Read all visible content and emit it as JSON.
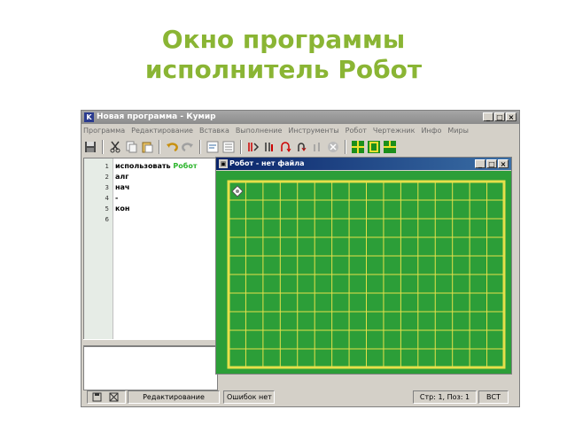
{
  "slide": {
    "title_line1": "Окно программы",
    "title_line2": "исполнитель Робот"
  },
  "window": {
    "app_icon": "K",
    "title": "Новая программа - Кумир",
    "minimize": "_",
    "maximize": "□",
    "close": "×"
  },
  "menu": [
    "Программа",
    "Редактирование",
    "Вставка",
    "Выполнение",
    "Инструменты",
    "Робот",
    "Чертежник",
    "Инфо",
    "Миры"
  ],
  "toolbar": {
    "icons": [
      "save-icon",
      "cut-icon",
      "copy-icon",
      "paste-icon",
      "undo-icon",
      "redo-icon",
      "insert-icon",
      "list-icon",
      "run-icon",
      "step-icon",
      "step-into-icon",
      "step-out-icon",
      "pause-icon",
      "stop-icon",
      "grid-icon",
      "square-icon",
      "field-icon"
    ]
  },
  "editor": {
    "line_numbers": [
      "1",
      "2",
      "3",
      "4",
      "5",
      "6"
    ],
    "lines": [
      {
        "pre": "использовать ",
        "robot": "Робот"
      },
      {
        "pre": "алг",
        "robot": ""
      },
      {
        "pre": "нач",
        "robot": ""
      },
      {
        "pre": "-",
        "robot": ""
      },
      {
        "pre": "кон",
        "robot": ""
      },
      {
        "pre": "",
        "robot": ""
      }
    ]
  },
  "robot_window": {
    "title": "Робот - нет файла",
    "minimize": "_",
    "maximize": "□",
    "close": "×",
    "colors": {
      "field": "#2c9e38",
      "grid": "#e6e04a",
      "wall": "#e6e04a"
    }
  },
  "statusbar": {
    "mode": "Редактирование",
    "errors": "Ошибок нет",
    "position": "Стр: 1, Поз: 1",
    "insert_mode": "ВСТ"
  }
}
